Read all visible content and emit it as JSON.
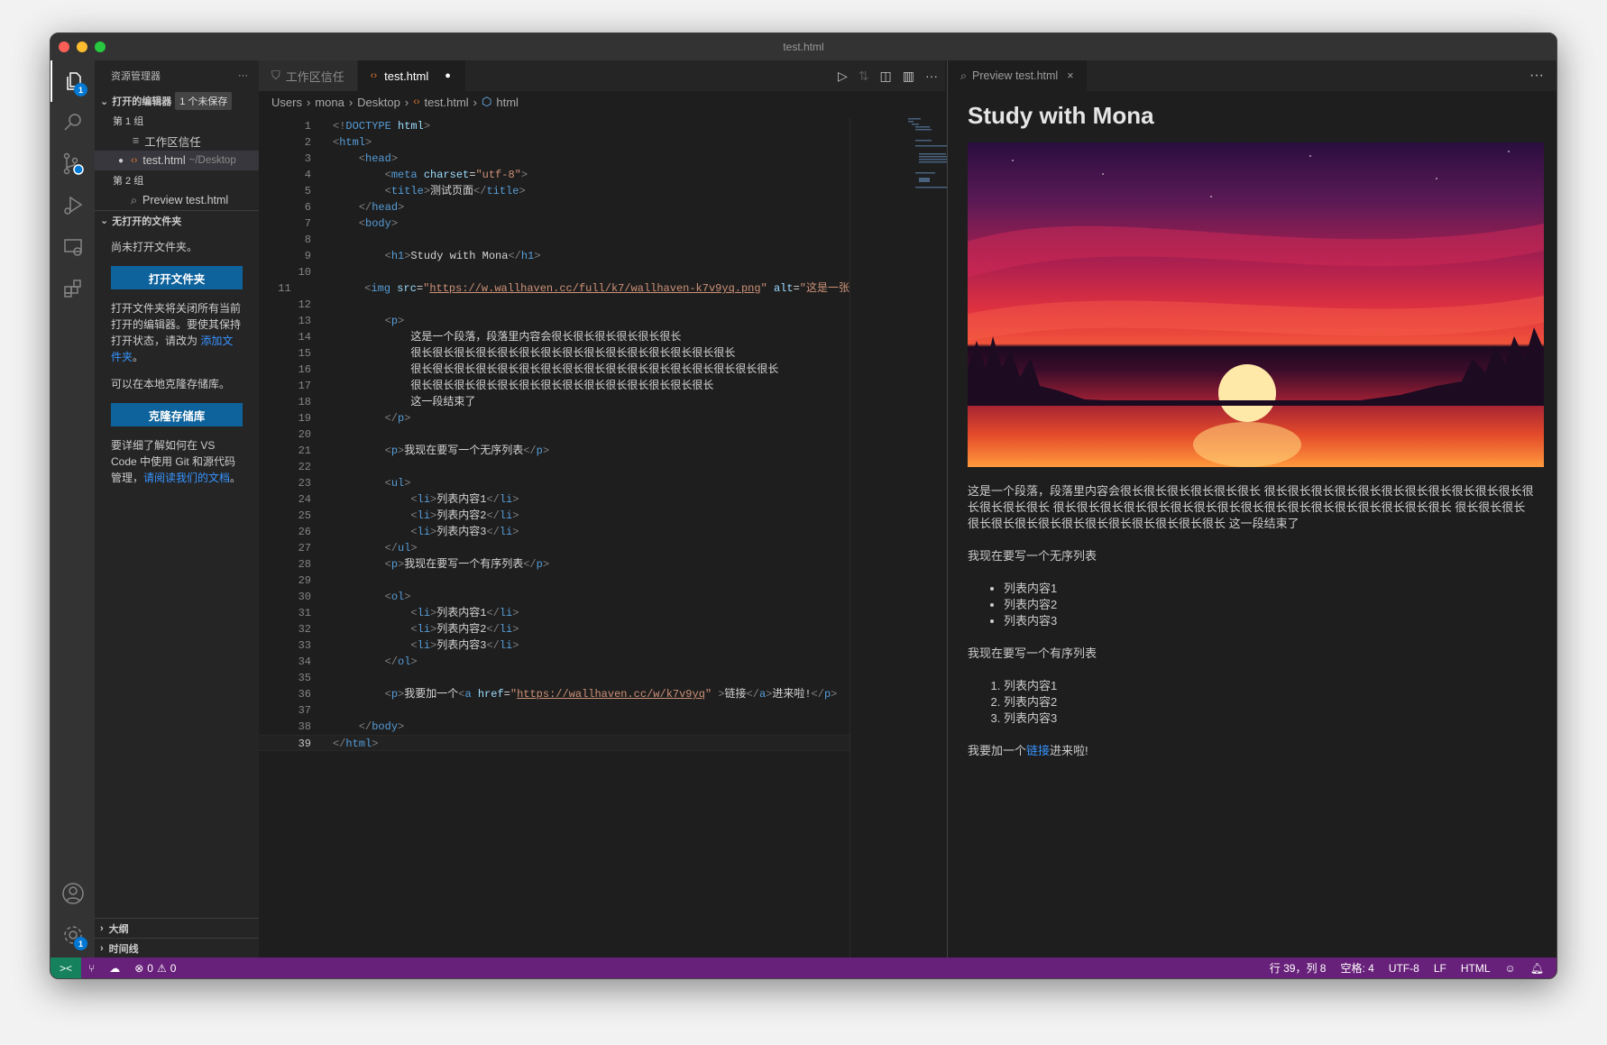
{
  "window": {
    "title": "test.html"
  },
  "activity": {
    "explorer_badge": "1",
    "settings_badge": "1",
    "items": [
      "files-icon",
      "search-icon",
      "source-control-icon",
      "run-debug-icon",
      "remote-explorer-icon",
      "extensions-icon",
      "account-icon",
      "settings-icon"
    ]
  },
  "sidebar": {
    "title": "资源管理器",
    "more": "···",
    "open_editors": "打开的编辑器",
    "unsaved": "1 个未保存",
    "group1": "第 1 组",
    "item1": "工作区信任",
    "item2": "test.html",
    "item2_desc": "~/Desktop",
    "group2": "第 2 组",
    "item3": "Preview test.html",
    "no_folder": "无打开的文件夹",
    "msg1": "尚未打开文件夹。",
    "open_btn": "打开文件夹",
    "msg2": "打开文件夹将关闭所有当前打开的编辑器。要使其保持打开状态，请改为 ",
    "msg2_link": "添加文件夹",
    "msg2_end": "。",
    "msg3": "可以在本地克隆存储库。",
    "clone_btn": "克隆存储库",
    "msg4": "要详细了解如何在 VS Code 中使用 Git 和源代码管理，",
    "msg4_link": "请阅读我们的文档",
    "msg4_end": "。",
    "outline": "大纲",
    "timeline": "时间线"
  },
  "editor": {
    "tabs": [
      {
        "label": "工作区信任"
      },
      {
        "label": "test.html",
        "dirty": true
      }
    ],
    "breadcrumb": [
      "Users",
      "mona",
      "Desktop",
      "test.html",
      "html"
    ],
    "current_line": 39,
    "lines": [
      [
        [
          "p",
          "<!"
        ],
        [
          "t",
          "DOCTYPE"
        ],
        [
          "x",
          " "
        ],
        [
          "a",
          "html"
        ],
        [
          "p",
          ">"
        ]
      ],
      [
        [
          "p",
          "<"
        ],
        [
          "t",
          "html"
        ],
        [
          "p",
          ">"
        ]
      ],
      [
        [
          "x",
          "    "
        ],
        [
          "p",
          "<"
        ],
        [
          "t",
          "head"
        ],
        [
          "p",
          ">"
        ]
      ],
      [
        [
          "x",
          "        "
        ],
        [
          "p",
          "<"
        ],
        [
          "t",
          "meta"
        ],
        [
          "x",
          " "
        ],
        [
          "a",
          "charset"
        ],
        [
          "x",
          "="
        ],
        [
          "s",
          "\"utf-8\""
        ],
        [
          "p",
          ">"
        ]
      ],
      [
        [
          "x",
          "        "
        ],
        [
          "p",
          "<"
        ],
        [
          "t",
          "title"
        ],
        [
          "p",
          ">"
        ],
        [
          "x",
          "测试页面"
        ],
        [
          "p",
          "</"
        ],
        [
          "t",
          "title"
        ],
        [
          "p",
          ">"
        ]
      ],
      [
        [
          "x",
          "    "
        ],
        [
          "p",
          "</"
        ],
        [
          "t",
          "head"
        ],
        [
          "p",
          ">"
        ]
      ],
      [
        [
          "x",
          "    "
        ],
        [
          "p",
          "<"
        ],
        [
          "t",
          "body"
        ],
        [
          "p",
          ">"
        ]
      ],
      [],
      [
        [
          "x",
          "        "
        ],
        [
          "p",
          "<"
        ],
        [
          "t",
          "h1"
        ],
        [
          "p",
          ">"
        ],
        [
          "x",
          "Study with Mona"
        ],
        [
          "p",
          "</"
        ],
        [
          "t",
          "h1"
        ],
        [
          "p",
          ">"
        ]
      ],
      [],
      [
        [
          "x",
          "        "
        ],
        [
          "p",
          "<"
        ],
        [
          "t",
          "img"
        ],
        [
          "x",
          " "
        ],
        [
          "a",
          "src"
        ],
        [
          "x",
          "="
        ],
        [
          "s",
          "\""
        ],
        [
          "u",
          "https://w.wallhaven.cc/full/k7/wallhaven-k7v9yq.png"
        ],
        [
          "s",
          "\""
        ],
        [
          "x",
          " "
        ],
        [
          "a",
          "alt"
        ],
        [
          "x",
          "="
        ],
        [
          "s",
          "\"这是一张"
        ]
      ],
      [],
      [
        [
          "x",
          "        "
        ],
        [
          "p",
          "<"
        ],
        [
          "t",
          "p"
        ],
        [
          "p",
          ">"
        ]
      ],
      [
        [
          "x",
          "            这是一个段落，段落里内容会很长很长很长很长很长很长"
        ]
      ],
      [
        [
          "x",
          "            很长很长很长很长很长很长很长很长很长很长很长很长很长很长很长"
        ]
      ],
      [
        [
          "x",
          "            很长很长很长很长很长很长很长很长很长很长很长很长很长很长很长很长很长"
        ]
      ],
      [
        [
          "x",
          "            很长很长很长很长很长很长很长很长很长很长很长很长很长很长"
        ]
      ],
      [
        [
          "x",
          "            这一段结束了"
        ]
      ],
      [
        [
          "x",
          "        "
        ],
        [
          "p",
          "</"
        ],
        [
          "t",
          "p"
        ],
        [
          "p",
          ">"
        ]
      ],
      [],
      [
        [
          "x",
          "        "
        ],
        [
          "p",
          "<"
        ],
        [
          "t",
          "p"
        ],
        [
          "p",
          ">"
        ],
        [
          "x",
          "我现在要写一个无序列表"
        ],
        [
          "p",
          "</"
        ],
        [
          "t",
          "p"
        ],
        [
          "p",
          ">"
        ]
      ],
      [],
      [
        [
          "x",
          "        "
        ],
        [
          "p",
          "<"
        ],
        [
          "t",
          "ul"
        ],
        [
          "p",
          ">"
        ]
      ],
      [
        [
          "x",
          "            "
        ],
        [
          "p",
          "<"
        ],
        [
          "t",
          "li"
        ],
        [
          "p",
          ">"
        ],
        [
          "x",
          "列表内容1"
        ],
        [
          "p",
          "</"
        ],
        [
          "t",
          "li"
        ],
        [
          "p",
          ">"
        ]
      ],
      [
        [
          "x",
          "            "
        ],
        [
          "p",
          "<"
        ],
        [
          "t",
          "li"
        ],
        [
          "p",
          ">"
        ],
        [
          "x",
          "列表内容2"
        ],
        [
          "p",
          "</"
        ],
        [
          "t",
          "li"
        ],
        [
          "p",
          ">"
        ]
      ],
      [
        [
          "x",
          "            "
        ],
        [
          "p",
          "<"
        ],
        [
          "t",
          "li"
        ],
        [
          "p",
          ">"
        ],
        [
          "x",
          "列表内容3"
        ],
        [
          "p",
          "</"
        ],
        [
          "t",
          "li"
        ],
        [
          "p",
          ">"
        ]
      ],
      [
        [
          "x",
          "        "
        ],
        [
          "p",
          "</"
        ],
        [
          "t",
          "ul"
        ],
        [
          "p",
          ">"
        ]
      ],
      [
        [
          "x",
          "        "
        ],
        [
          "p",
          "<"
        ],
        [
          "t",
          "p"
        ],
        [
          "p",
          ">"
        ],
        [
          "x",
          "我现在要写一个有序列表"
        ],
        [
          "p",
          "</"
        ],
        [
          "t",
          "p"
        ],
        [
          "p",
          ">"
        ]
      ],
      [],
      [
        [
          "x",
          "        "
        ],
        [
          "p",
          "<"
        ],
        [
          "t",
          "ol"
        ],
        [
          "p",
          ">"
        ]
      ],
      [
        [
          "x",
          "            "
        ],
        [
          "p",
          "<"
        ],
        [
          "t",
          "li"
        ],
        [
          "p",
          ">"
        ],
        [
          "x",
          "列表内容1"
        ],
        [
          "p",
          "</"
        ],
        [
          "t",
          "li"
        ],
        [
          "p",
          ">"
        ]
      ],
      [
        [
          "x",
          "            "
        ],
        [
          "p",
          "<"
        ],
        [
          "t",
          "li"
        ],
        [
          "p",
          ">"
        ],
        [
          "x",
          "列表内容2"
        ],
        [
          "p",
          "</"
        ],
        [
          "t",
          "li"
        ],
        [
          "p",
          ">"
        ]
      ],
      [
        [
          "x",
          "            "
        ],
        [
          "p",
          "<"
        ],
        [
          "t",
          "li"
        ],
        [
          "p",
          ">"
        ],
        [
          "x",
          "列表内容3"
        ],
        [
          "p",
          "</"
        ],
        [
          "t",
          "li"
        ],
        [
          "p",
          ">"
        ]
      ],
      [
        [
          "x",
          "        "
        ],
        [
          "p",
          "</"
        ],
        [
          "t",
          "ol"
        ],
        [
          "p",
          ">"
        ]
      ],
      [],
      [
        [
          "x",
          "        "
        ],
        [
          "p",
          "<"
        ],
        [
          "t",
          "p"
        ],
        [
          "p",
          ">"
        ],
        [
          "x",
          "我要加一个"
        ],
        [
          "p",
          "<"
        ],
        [
          "t",
          "a"
        ],
        [
          "x",
          " "
        ],
        [
          "a",
          "href"
        ],
        [
          "x",
          "="
        ],
        [
          "s",
          "\""
        ],
        [
          "u",
          "https://wallhaven.cc/w/k7v9yq"
        ],
        [
          "s",
          "\""
        ],
        [
          "x",
          " "
        ],
        [
          "p",
          ">"
        ],
        [
          "x",
          "链接"
        ],
        [
          "p",
          "</"
        ],
        [
          "t",
          "a"
        ],
        [
          "p",
          ">"
        ],
        [
          "x",
          "进来啦!"
        ],
        [
          "p",
          "</"
        ],
        [
          "t",
          "p"
        ],
        [
          "p",
          ">"
        ]
      ],
      [],
      [
        [
          "x",
          "    "
        ],
        [
          "p",
          "</"
        ],
        [
          "t",
          "body"
        ],
        [
          "p",
          ">"
        ]
      ],
      [
        [
          "p",
          "</"
        ],
        [
          "t",
          "html"
        ],
        [
          "p",
          ">"
        ]
      ]
    ]
  },
  "preview": {
    "tab": "Preview test.html",
    "more": "···",
    "h1": "Study with Mona",
    "paragraph": "这是一个段落，段落里内容会很长很长很长很长很长很长 很长很长很长很长很长很长很长很长很长很长很长很长很长很长很长 很长很长很长很长很长很长很长很长很长很长很长很长很长很长很长很长很长 很长很长很长很长很长很长很长很长很长很长很长很长很长很长 这一段结束了",
    "ul_title": "我现在要写一个无序列表",
    "ul": [
      "列表内容1",
      "列表内容2",
      "列表内容3"
    ],
    "ol_title": "我现在要写一个有序列表",
    "ol": [
      "列表内容1",
      "列表内容2",
      "列表内容3"
    ],
    "link_pre": "我要加一个",
    "link": "链接",
    "link_post": "进来啦!"
  },
  "status": {
    "errors": "0",
    "warnings": "0",
    "position": "行 39，列 8",
    "spaces": "空格: 4",
    "encoding": "UTF-8",
    "eol": "LF",
    "language": "HTML",
    "colors": {
      "bar": "#68217a",
      "remote": "#16825d"
    }
  }
}
